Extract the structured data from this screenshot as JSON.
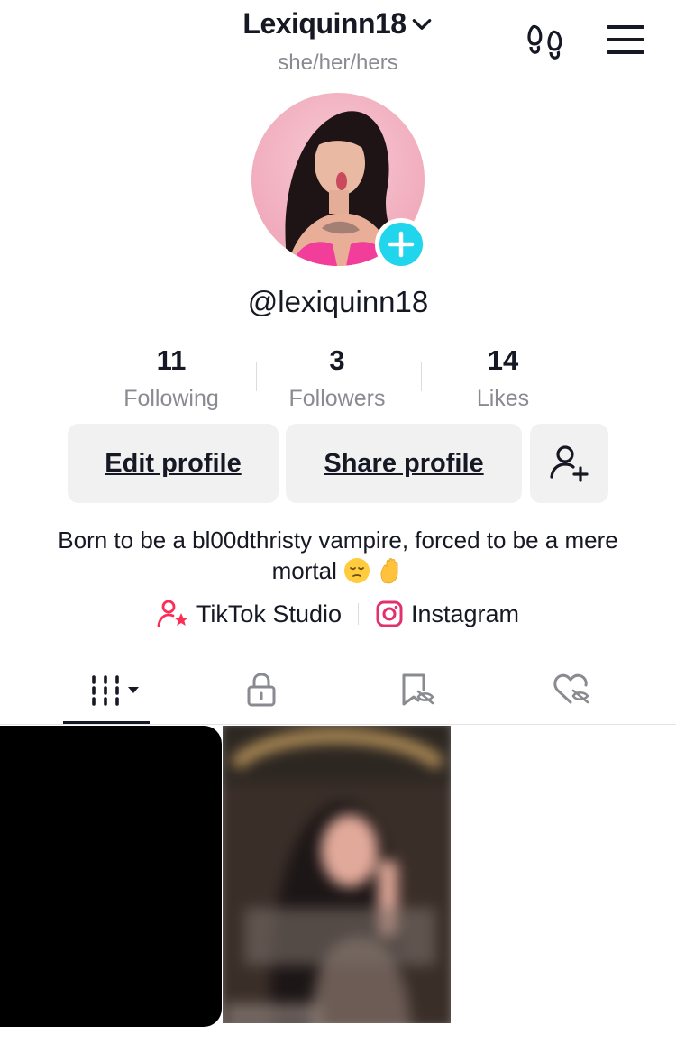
{
  "header": {
    "username": "Lexiquinn18",
    "pronouns": "she/her/hers",
    "icons": {
      "profile_views": "footprints-icon",
      "menu": "hamburger-menu-icon",
      "account_switch": "chevron-down-icon"
    }
  },
  "profile": {
    "handle": "@lexiquinn18",
    "avatar_add_icon": "plus-icon"
  },
  "stats": [
    {
      "value": "11",
      "label": "Following"
    },
    {
      "value": "3",
      "label": "Followers"
    },
    {
      "value": "14",
      "label": "Likes"
    }
  ],
  "actions": {
    "edit_profile": "Edit profile",
    "share_profile": "Share profile",
    "add_friends_icon": "add-friend-icon"
  },
  "bio": {
    "text": "Born to be a bl00dthristy vampire, forced to be a mere mortal",
    "emojis": [
      "pensive-face",
      "raised-hand"
    ]
  },
  "links": [
    {
      "label": "TikTok Studio",
      "icon": "person-star-icon"
    },
    {
      "label": "Instagram",
      "icon": "instagram-icon"
    }
  ],
  "tabs": [
    {
      "name": "videos",
      "icon": "grid-bars-icon",
      "active": true
    },
    {
      "name": "private",
      "icon": "lock-icon",
      "active": false
    },
    {
      "name": "favorites",
      "icon": "bookmark-hidden-icon",
      "active": false
    },
    {
      "name": "liked",
      "icon": "heart-hidden-icon",
      "active": false
    }
  ],
  "colors": {
    "accent_cyan": "#20d5ec",
    "text_primary": "#161823",
    "text_secondary": "#8a8b91",
    "button_bg": "#f1f1f2",
    "brand_pink": "#fe2c55"
  }
}
